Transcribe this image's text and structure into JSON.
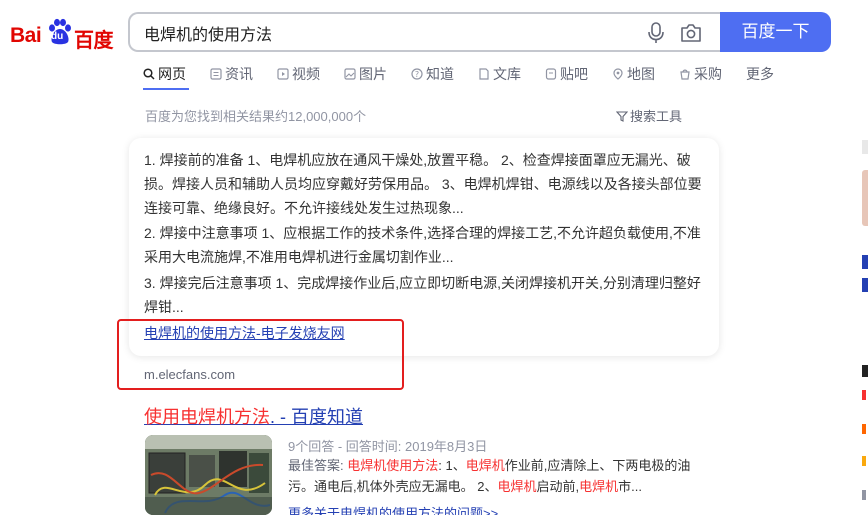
{
  "logo": {
    "left_text": "Bai",
    "paw_text": "du",
    "right_text": "百度"
  },
  "search": {
    "query": "电焊机的使用方法",
    "button_label": "百度一下"
  },
  "tabs": [
    {
      "label": "网页"
    },
    {
      "label": "资讯"
    },
    {
      "label": "视频"
    },
    {
      "label": "图片"
    },
    {
      "label": "知道"
    },
    {
      "label": "文库"
    },
    {
      "label": "贴吧"
    },
    {
      "label": "地图"
    },
    {
      "label": "采购"
    },
    {
      "label": "更多"
    }
  ],
  "result_count": "百度为您找到相关结果约12,000,000个",
  "tools_label": "搜索工具",
  "featured": {
    "para1": "1. 焊接前的准备 1、电焊机应放在通风干燥处,放置平稳。 2、检查焊接面罩应无漏光、破损。焊接人员和辅助人员均应穿戴好劳保用品。 3、电焊机焊钳、电源线以及各接头部位要连接可靠、绝缘良好。不允许接线处发生过热现象...",
    "para2": "2. 焊接中注意事项 1、应根据工作的技术条件,选择合理的焊接工艺,不允许超负载使用,不准采用大电流施焊,不准用电焊机进行金属切割作业...",
    "para3": "3. 焊接完后注意事项 1、完成焊接作业后,应立即切断电源,关闭焊接机开关,分别清理归整好焊钳...",
    "source_link": "电焊机的使用方法-电子发烧友网",
    "domain": "m.elecfans.com"
  },
  "result2": {
    "title_hl": "使用电焊机方法",
    "title_rest": ". - 百度知道",
    "meta": "9个回答 - 回答时间: 2019年8月3日",
    "answer_label": "最佳答案: ",
    "answer_hl1": "电焊机使用方法",
    "answer_t1": ": 1、",
    "answer_hl2": "电焊机",
    "answer_t2": "作业前,应清除上、下两电极的油污。通电后,机体外壳应无漏电。 2、",
    "answer_hl3": "电焊机",
    "answer_t3": "启动前,",
    "answer_hl4": "电焊机",
    "answer_t4": "市...",
    "more_link": "更多关于电焊机的使用方法的问题>>"
  },
  "colors": {
    "brand": "#4e6ef2",
    "logo_red": "#e10602",
    "link": "#2440b3",
    "highlight": "#f73131",
    "annotation": "#e31e1e"
  }
}
